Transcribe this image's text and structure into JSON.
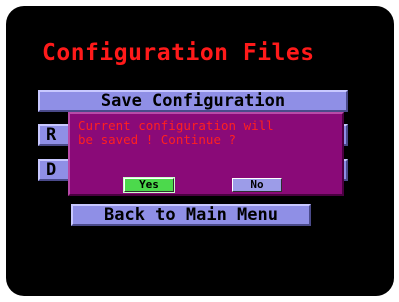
{
  "screen": {
    "title": "Configuration Files"
  },
  "menu": {
    "save_label": "Save Configuration",
    "item2_visible": "R",
    "item3_visible": "D",
    "back_label": "Back to Main Menu"
  },
  "dialog": {
    "message": "Current configuration will\nbe saved ! Continue ?",
    "yes_label": "Yes",
    "no_label": "No",
    "selected": "Yes"
  },
  "colors": {
    "background": "#000000",
    "title": "#ff1a1a",
    "menu_button": "#8f8fe6",
    "dialog_bg": "#8a0a78",
    "dialog_text": "#ff2020",
    "yes_selected": "#4cd94c",
    "no_button": "#9c9ce8"
  }
}
